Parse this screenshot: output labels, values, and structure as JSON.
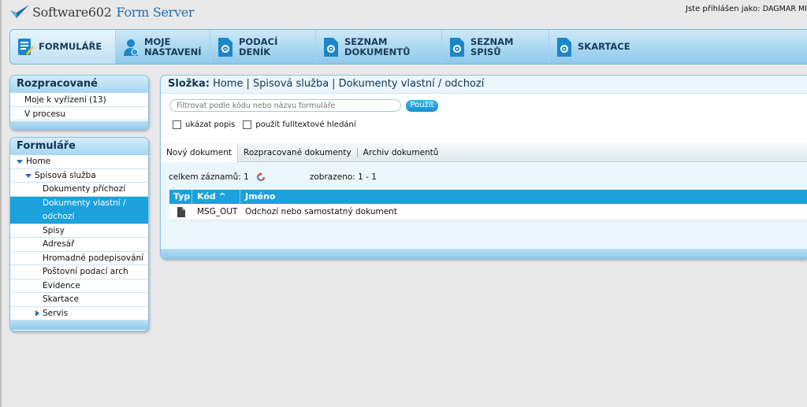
{
  "header": {
    "logo_brand": "Software602",
    "logo_product": "Form Server",
    "user_prefix": "Jste přihlášen jako:",
    "user_name": "DAGMAR MILI"
  },
  "nav": {
    "items": [
      {
        "label": "FORMULÁŘE",
        "icon": "form-icon"
      },
      {
        "label": "MOJE\nNASTAVENÍ",
        "icon": "user-icon"
      },
      {
        "label": "PODACÍ DENÍK",
        "icon": "document-gear-icon"
      },
      {
        "label": "SEZNAM\nDOKUMENTŮ",
        "icon": "document-gear-icon"
      },
      {
        "label": "SEZNAM SPISŮ",
        "icon": "document-gear-icon"
      },
      {
        "label": "SKARTACE",
        "icon": "document-gear-icon"
      }
    ]
  },
  "panel_drafts": {
    "title": "Rozpracované",
    "items": [
      "Moje k vyřízení (13)",
      "V procesu"
    ]
  },
  "panel_forms": {
    "title": "Formuláře",
    "tree": [
      {
        "label": "Home"
      },
      {
        "label": "Spisová služba"
      },
      {
        "label": "Dokumenty příchozí"
      },
      {
        "label": "Dokumenty vlastní / odchozí"
      },
      {
        "label": "Spisy"
      },
      {
        "label": "Adresář"
      },
      {
        "label": "Hromadné podepisování"
      },
      {
        "label": "Poštovní podací arch"
      },
      {
        "label": "Evidence"
      },
      {
        "label": "Skartace"
      },
      {
        "label": "Servis"
      }
    ]
  },
  "content": {
    "breadcrumb_label": "Složka:",
    "breadcrumb": [
      "Home",
      "Spisová služba",
      "Dokumenty vlastní / odchozí"
    ],
    "search_placeholder": "Filtrovat podle kódu nebo názvu formuláře",
    "search_button": "Použít",
    "check_description": "ukázat popis",
    "check_fulltext": "použít fulltextové hledání",
    "tabs": [
      "Nový dokument",
      "Rozpracované dokumenty",
      "Archiv dokumentů"
    ],
    "total_records": "celkem záznamů: 1",
    "shown_records": "zobrazeno: 1 - 1",
    "table": {
      "columns": [
        "Typ",
        "Kód ^",
        "Jméno"
      ],
      "rows": [
        {
          "code": "MSG_OUT",
          "name": "Odchozí nebo samostatný dokument"
        }
      ]
    }
  },
  "colors": {
    "accent": "#1ba1dc",
    "nav_bg": "#8dc9ec",
    "brand_blue": "#1f6fb0"
  }
}
